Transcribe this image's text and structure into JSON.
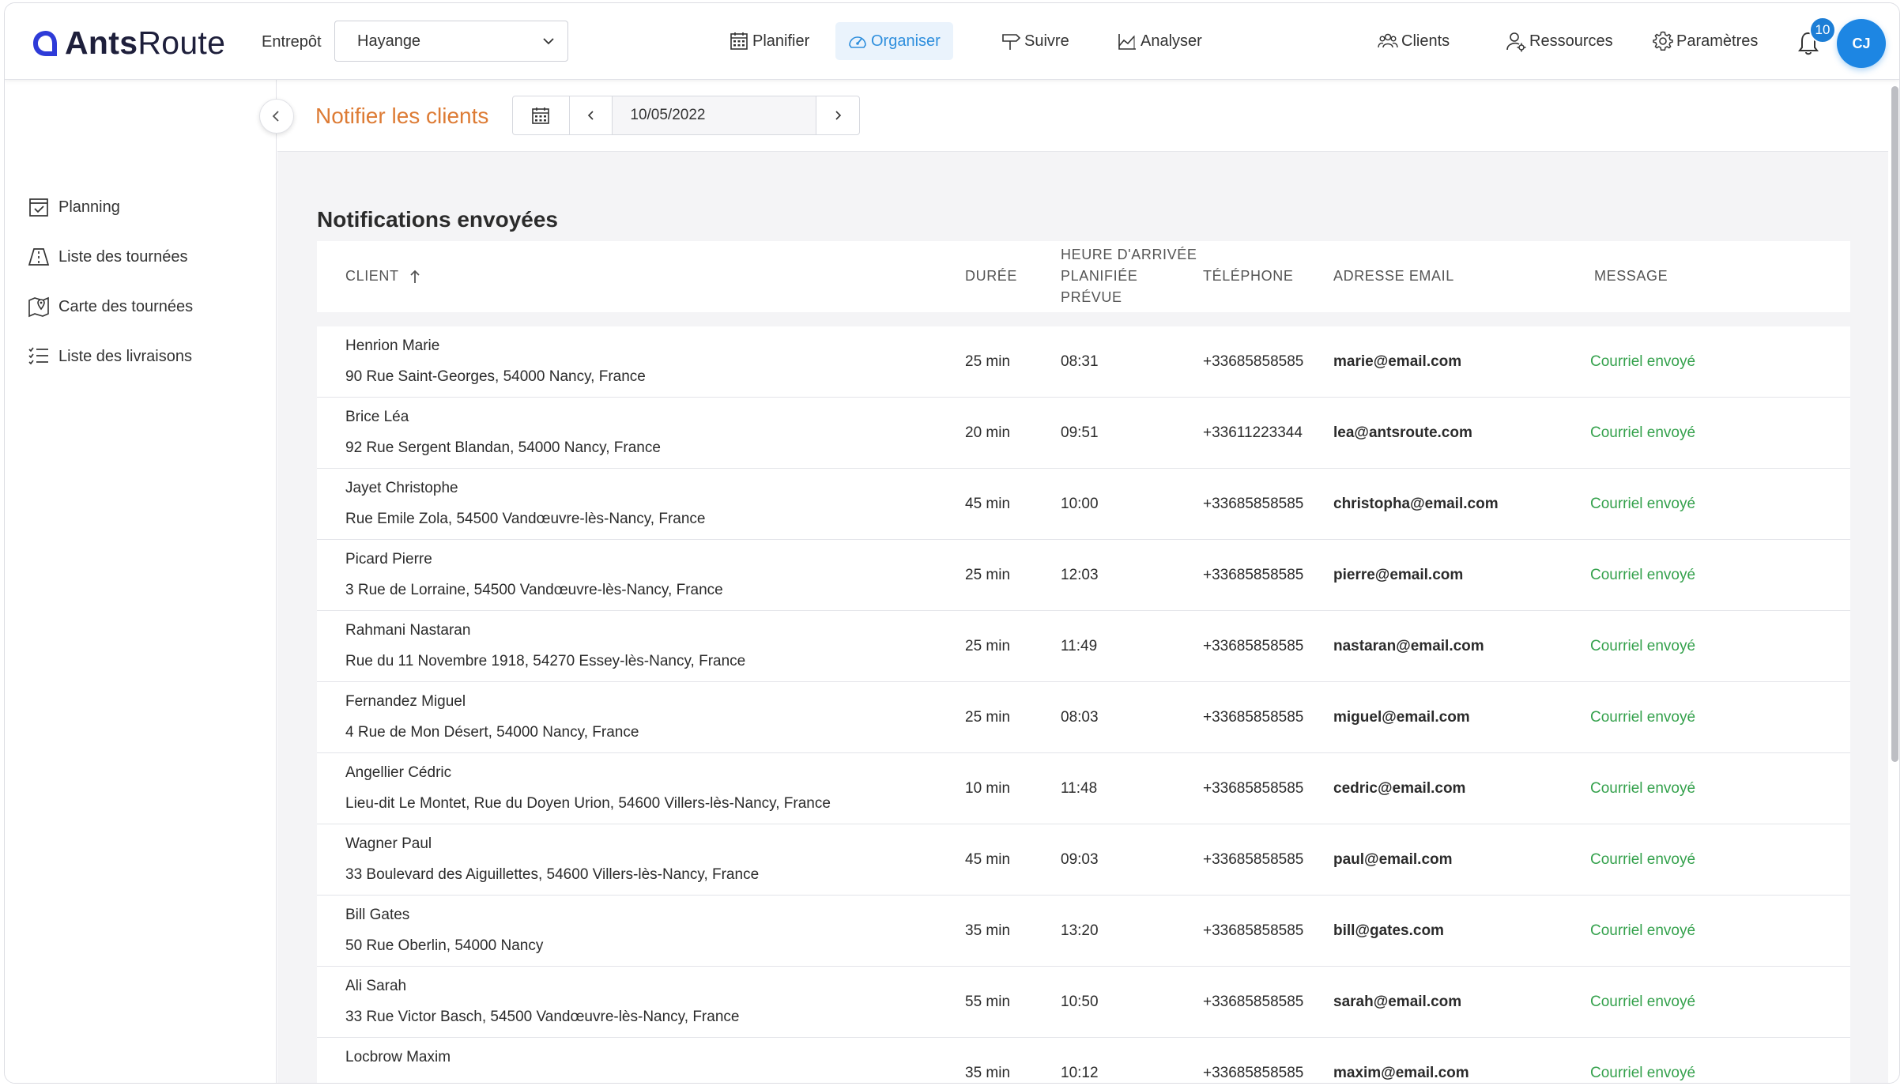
{
  "app": {
    "logo_text_bold": "Ants",
    "logo_text_light": "Route",
    "accent_color": "#2f8fdd",
    "title_color": "#dd7b34",
    "success_color": "#34a14c"
  },
  "topbar": {
    "warehouse_label": "Entrepôt",
    "warehouse_value": "Hayange",
    "nav": [
      {
        "label": "Planifier",
        "icon": "calendar-grid-icon",
        "active": false
      },
      {
        "label": "Organiser",
        "icon": "speedometer-icon",
        "active": true
      },
      {
        "label": "Suivre",
        "icon": "signpost-icon",
        "active": false
      },
      {
        "label": "Analyser",
        "icon": "chart-icon",
        "active": false
      }
    ],
    "right_nav": [
      {
        "label": "Clients",
        "icon": "people-icon"
      },
      {
        "label": "Ressources",
        "icon": "user-gear-icon"
      },
      {
        "label": "Paramètres",
        "icon": "gear-icon"
      }
    ],
    "notification_count": "10",
    "avatar_initials": "CJ"
  },
  "sidebar": {
    "items": [
      {
        "label": "Planning",
        "icon": "calendar-check-icon"
      },
      {
        "label": "Liste des tournées",
        "icon": "road-icon"
      },
      {
        "label": "Carte des tournées",
        "icon": "map-pin-icon"
      },
      {
        "label": "Liste des livraisons",
        "icon": "checklist-icon"
      }
    ]
  },
  "header": {
    "title": "Notifier les clients",
    "date": "10/05/2022"
  },
  "table": {
    "section_title": "Notifications envoyées",
    "columns": {
      "client": "CLIENT",
      "duration": "DURÉE",
      "arrival_line1": "HEURE D'ARRIVÉE",
      "arrival_line2": "PLANIFIÉE",
      "arrival_line3": "PRÉVUE",
      "phone": "TÉLÉPHONE",
      "email": "ADRESSE EMAIL",
      "message": "MESSAGE"
    },
    "rows": [
      {
        "name": "Henrion Marie",
        "address": "90 Rue Saint-Georges, 54000 Nancy, France",
        "duration": "25 min",
        "time": "08:31",
        "phone": "+33685858585",
        "email": "marie@email.com",
        "message": "Courriel envoyé"
      },
      {
        "name": "Brice Léa",
        "address": "92 Rue Sergent Blandan, 54000 Nancy, France",
        "duration": "20 min",
        "time": "09:51",
        "phone": "+33611223344",
        "email": "lea@antsroute.com",
        "message": "Courriel envoyé"
      },
      {
        "name": "Jayet Christophe",
        "address": "Rue Emile Zola, 54500 Vandœuvre-lès-Nancy, France",
        "duration": "45 min",
        "time": "10:00",
        "phone": "+33685858585",
        "email": "christopha@email.com",
        "message": "Courriel envoyé"
      },
      {
        "name": "Picard Pierre",
        "address": "3 Rue de Lorraine, 54500 Vandœuvre-lès-Nancy, France",
        "duration": "25 min",
        "time": "12:03",
        "phone": "+33685858585",
        "email": "pierre@email.com",
        "message": "Courriel envoyé"
      },
      {
        "name": "Rahmani Nastaran",
        "address": "Rue du 11 Novembre 1918, 54270 Essey-lès-Nancy, France",
        "duration": "25 min",
        "time": "11:49",
        "phone": "+33685858585",
        "email": "nastaran@email.com",
        "message": "Courriel envoyé"
      },
      {
        "name": "Fernandez Miguel",
        "address": "4 Rue de Mon Désert, 54000 Nancy, France",
        "duration": "25 min",
        "time": "08:03",
        "phone": "+33685858585",
        "email": "miguel@email.com",
        "message": "Courriel envoyé"
      },
      {
        "name": "Angellier Cédric",
        "address": "Lieu-dit Le Montet, Rue du Doyen Urion, 54600 Villers-lès-Nancy, France",
        "duration": "10 min",
        "time": "11:48",
        "phone": "+33685858585",
        "email": "cedric@email.com",
        "message": "Courriel envoyé"
      },
      {
        "name": "Wagner Paul",
        "address": "33 Boulevard des Aiguillettes, 54600 Villers-lès-Nancy, France",
        "duration": "45 min",
        "time": "09:03",
        "phone": "+33685858585",
        "email": "paul@email.com",
        "message": "Courriel envoyé"
      },
      {
        "name": "Bill Gates",
        "address": "50 Rue Oberlin, 54000 Nancy",
        "duration": "35 min",
        "time": "13:20",
        "phone": "+33685858585",
        "email": "bill@gates.com",
        "message": "Courriel envoyé"
      },
      {
        "name": "Ali Sarah",
        "address": "33 Rue Victor Basch, 54500 Vandœuvre-lès-Nancy, France",
        "duration": "55 min",
        "time": "10:50",
        "phone": "+33685858585",
        "email": "sarah@email.com",
        "message": "Courriel envoyé"
      },
      {
        "name": "Locbrow Maxim",
        "address": "",
        "duration": "35 min",
        "time": "10:12",
        "phone": "+33685858585",
        "email": "maxim@email.com",
        "message": "Courriel envoyé"
      }
    ]
  }
}
